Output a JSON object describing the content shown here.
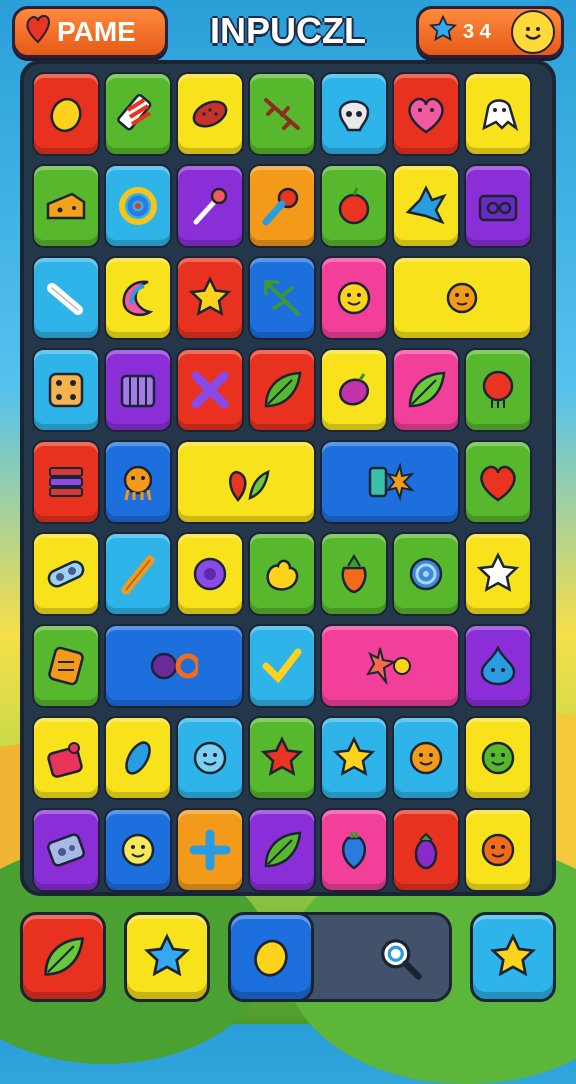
{
  "header": {
    "left_button_label": "PAME",
    "title": "INPUCZL",
    "score_value": "3 4"
  },
  "colors": {
    "red": "#e8321f",
    "green": "#57b82e",
    "yellow": "#f8e21c",
    "sky": "#2fb4ea",
    "purple": "#8a2ed8",
    "orange": "#f39a1a",
    "blue": "#1d6fde",
    "pink": "#f2409a",
    "board": "#24374a"
  },
  "tiles": [
    {
      "row": 0,
      "col": 0,
      "w": 1,
      "bg": "red",
      "icon": "lemon-icon"
    },
    {
      "row": 0,
      "col": 1,
      "w": 1,
      "bg": "green",
      "icon": "striped-candy-icon"
    },
    {
      "row": 0,
      "col": 2,
      "w": 1,
      "bg": "yellow",
      "icon": "seed-icon"
    },
    {
      "row": 0,
      "col": 3,
      "w": 1,
      "bg": "green",
      "icon": "branch-icon"
    },
    {
      "row": 0,
      "col": 4,
      "w": 1,
      "bg": "sky",
      "icon": "skull-icon"
    },
    {
      "row": 0,
      "col": 5,
      "w": 1,
      "bg": "red",
      "icon": "heart-face-icon"
    },
    {
      "row": 0,
      "col": 6,
      "w": 1,
      "bg": "yellow",
      "icon": "ghost-icon"
    },
    {
      "row": 1,
      "col": 0,
      "w": 1,
      "bg": "green",
      "icon": "cheese-icon"
    },
    {
      "row": 1,
      "col": 1,
      "w": 1,
      "bg": "sky",
      "icon": "swirl-icon"
    },
    {
      "row": 1,
      "col": 2,
      "w": 1,
      "bg": "purple",
      "icon": "wand-icon"
    },
    {
      "row": 1,
      "col": 3,
      "w": 1,
      "bg": "orange",
      "icon": "pin-icon"
    },
    {
      "row": 1,
      "col": 4,
      "w": 1,
      "bg": "green",
      "icon": "apple-icon"
    },
    {
      "row": 1,
      "col": 5,
      "w": 1,
      "bg": "yellow",
      "icon": "bird-icon"
    },
    {
      "row": 1,
      "col": 6,
      "w": 1,
      "bg": "purple",
      "icon": "camera-icon"
    },
    {
      "row": 2,
      "col": 0,
      "w": 1,
      "bg": "sky",
      "icon": "bone-icon"
    },
    {
      "row": 2,
      "col": 1,
      "w": 1,
      "bg": "yellow",
      "icon": "moon-icon"
    },
    {
      "row": 2,
      "col": 2,
      "w": 1,
      "bg": "red",
      "icon": "star-icon"
    },
    {
      "row": 2,
      "col": 3,
      "w": 1,
      "bg": "blue",
      "icon": "arrow-icon"
    },
    {
      "row": 2,
      "col": 4,
      "w": 1,
      "bg": "pink",
      "icon": "smile-blob-icon"
    },
    {
      "row": 2,
      "col": 5,
      "w": 2,
      "bg": "yellow",
      "icon": "faces-pair-icon"
    },
    {
      "row": 3,
      "col": 0,
      "w": 1,
      "bg": "sky",
      "icon": "dice-icon"
    },
    {
      "row": 3,
      "col": 1,
      "w": 1,
      "bg": "purple",
      "icon": "cage-icon"
    },
    {
      "row": 3,
      "col": 2,
      "w": 1,
      "bg": "red",
      "icon": "cross-icon"
    },
    {
      "row": 3,
      "col": 3,
      "w": 1,
      "bg": "red",
      "icon": "leaf-hand-icon"
    },
    {
      "row": 3,
      "col": 4,
      "w": 1,
      "bg": "yellow",
      "icon": "plum-icon"
    },
    {
      "row": 3,
      "col": 5,
      "w": 1,
      "bg": "pink",
      "icon": "leaf-icon"
    },
    {
      "row": 3,
      "col": 6,
      "w": 1,
      "bg": "green",
      "icon": "balloon-icon"
    },
    {
      "row": 4,
      "col": 0,
      "w": 1,
      "bg": "red",
      "icon": "layers-icon"
    },
    {
      "row": 4,
      "col": 1,
      "w": 1,
      "bg": "blue",
      "icon": "octopus-icon"
    },
    {
      "row": 4,
      "col": 2,
      "w": 2,
      "bg": "yellow",
      "icon": "strawberry-leaf-icon"
    },
    {
      "row": 4,
      "col": 4,
      "w": 2,
      "bg": "blue",
      "icon": "card-burst-icon"
    },
    {
      "row": 4,
      "col": 6,
      "w": 1,
      "bg": "green",
      "icon": "heart-icon"
    },
    {
      "row": 5,
      "col": 0,
      "w": 1,
      "bg": "yellow",
      "icon": "bandage-icon"
    },
    {
      "row": 5,
      "col": 1,
      "w": 1,
      "bg": "sky",
      "icon": "pencil-icon"
    },
    {
      "row": 5,
      "col": 2,
      "w": 1,
      "bg": "yellow",
      "icon": "ring-icon"
    },
    {
      "row": 5,
      "col": 3,
      "w": 1,
      "bg": "green",
      "icon": "blob-icon"
    },
    {
      "row": 5,
      "col": 4,
      "w": 1,
      "bg": "green",
      "icon": "carrot-icon"
    },
    {
      "row": 5,
      "col": 5,
      "w": 1,
      "bg": "green",
      "icon": "target-icon"
    },
    {
      "row": 5,
      "col": 6,
      "w": 1,
      "bg": "yellow",
      "icon": "star-face-icon"
    },
    {
      "row": 6,
      "col": 0,
      "w": 1,
      "bg": "green",
      "icon": "waffle-icon"
    },
    {
      "row": 6,
      "col": 1,
      "w": 2,
      "bg": "blue",
      "icon": "gear-ring-icon"
    },
    {
      "row": 6,
      "col": 3,
      "w": 1,
      "bg": "sky",
      "icon": "check-icon"
    },
    {
      "row": 6,
      "col": 4,
      "w": 2,
      "bg": "pink",
      "icon": "starfish-sun-icon"
    },
    {
      "row": 6,
      "col": 6,
      "w": 1,
      "bg": "purple",
      "icon": "drop-face-icon"
    },
    {
      "row": 7,
      "col": 0,
      "w": 1,
      "bg": "yellow",
      "icon": "bag-icon"
    },
    {
      "row": 7,
      "col": 1,
      "w": 1,
      "bg": "yellow",
      "icon": "feather-icon"
    },
    {
      "row": 7,
      "col": 2,
      "w": 1,
      "bg": "sky",
      "icon": "blue-face-icon"
    },
    {
      "row": 7,
      "col": 3,
      "w": 1,
      "bg": "green",
      "icon": "red-star-icon"
    },
    {
      "row": 7,
      "col": 4,
      "w": 1,
      "bg": "sky",
      "icon": "yellow-star-icon"
    },
    {
      "row": 7,
      "col": 5,
      "w": 1,
      "bg": "sky",
      "icon": "orange-face-icon"
    },
    {
      "row": 7,
      "col": 6,
      "w": 1,
      "bg": "yellow",
      "icon": "frog-icon"
    },
    {
      "row": 8,
      "col": 0,
      "w": 1,
      "bg": "purple",
      "icon": "speaker-icon"
    },
    {
      "row": 8,
      "col": 1,
      "w": 1,
      "bg": "blue",
      "icon": "egg-face-icon"
    },
    {
      "row": 8,
      "col": 2,
      "w": 1,
      "bg": "orange",
      "icon": "plus-icon"
    },
    {
      "row": 8,
      "col": 3,
      "w": 1,
      "bg": "purple",
      "icon": "green-leaf-icon"
    },
    {
      "row": 8,
      "col": 4,
      "w": 1,
      "bg": "pink",
      "icon": "vase-icon"
    },
    {
      "row": 8,
      "col": 5,
      "w": 1,
      "bg": "red",
      "icon": "eggplant-icon"
    },
    {
      "row": 8,
      "col": 6,
      "w": 1,
      "bg": "yellow",
      "icon": "orange-blob-icon"
    }
  ],
  "bottom_bar": [
    {
      "id": "leaf-button",
      "bg": "red",
      "icon": "leaf-icon"
    },
    {
      "id": "star-button",
      "bg": "yellow",
      "icon": "blue-star-icon"
    },
    {
      "id": "lemon-button",
      "bg": "blue",
      "icon": "lemon-icon"
    },
    {
      "id": "search-button",
      "bg": "blue",
      "icon": "search-icon"
    },
    {
      "id": "gold-star-button",
      "bg": "sky",
      "icon": "star-icon"
    }
  ]
}
